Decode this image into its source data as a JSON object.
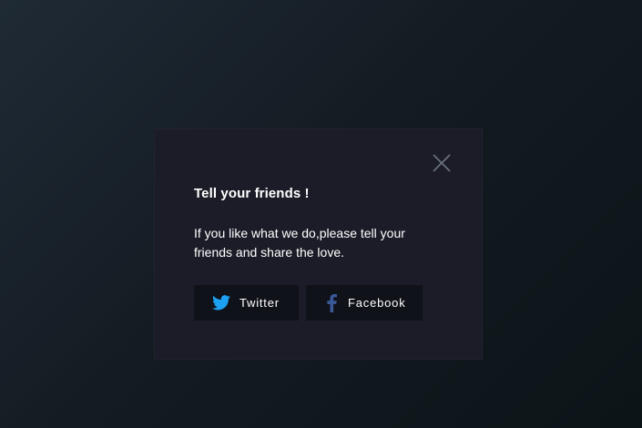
{
  "modal": {
    "title": "Tell your friends !",
    "message": "If you like what we do,please tell your friends and share the love.",
    "close_icon": "close-icon"
  },
  "share_buttons": [
    {
      "label": "Twitter",
      "icon": "twitter-icon",
      "color": "#1da1f2"
    },
    {
      "label": "Facebook",
      "icon": "facebook-icon",
      "color": "#3b5998"
    }
  ],
  "colors": {
    "modal_background": "#1b1c27",
    "button_background": "#10121a",
    "text": "#ffffff",
    "close_icon": "#6b7480"
  }
}
